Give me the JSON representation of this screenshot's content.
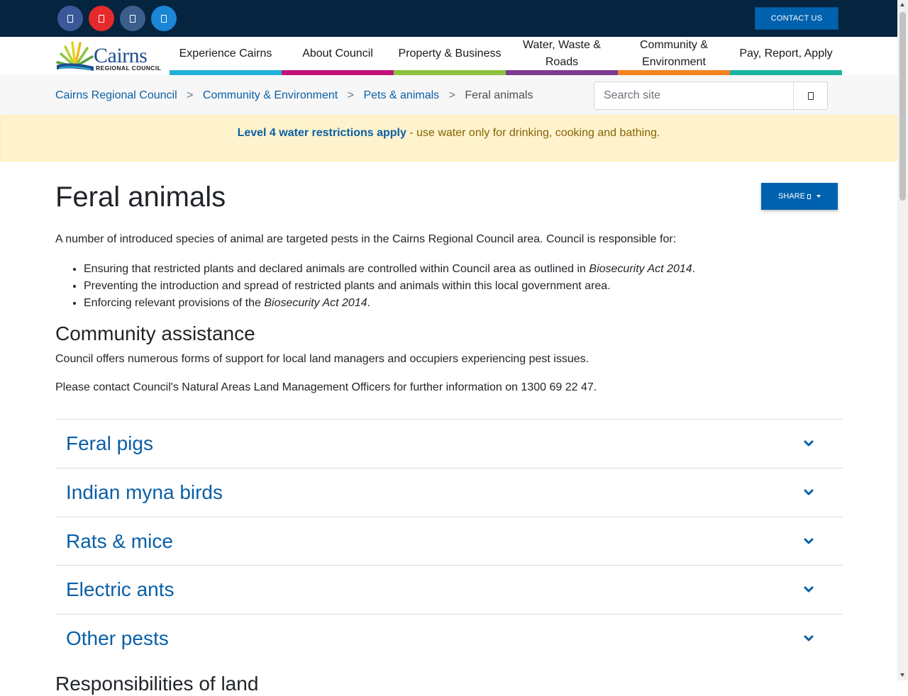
{
  "colors": {
    "topbar": "#05243f",
    "primary": "#0062ae",
    "link": "#0a5fa6",
    "facebook": "#3b5998",
    "youtube": "#e62a2a",
    "instagram": "#3a5f8c",
    "twitter": "#1b85d6",
    "alert_bg": "#fff3cd",
    "alert_text": "#856404"
  },
  "topbar": {
    "social": [
      {
        "name": "facebook-icon"
      },
      {
        "name": "youtube-icon"
      },
      {
        "name": "instagram-icon"
      },
      {
        "name": "twitter-icon"
      }
    ],
    "contact_label": "CONTACT US"
  },
  "logo": {
    "word": "Cairns",
    "sub": "REGIONAL COUNCIL"
  },
  "nav": {
    "items": [
      {
        "label": "Experience Cairns",
        "color": "#23b1d9"
      },
      {
        "label": "About Council",
        "color": "#c2127a"
      },
      {
        "label": "Property & Business",
        "color": "#8cc43f"
      },
      {
        "label": "Water, Waste & Roads",
        "color": "#7b3a8f"
      },
      {
        "label": "Community & Environment",
        "color": "#f5821f"
      },
      {
        "label": "Pay, Report, Apply",
        "color": "#19b3a0"
      }
    ]
  },
  "breadcrumb": {
    "items": [
      "Cairns Regional Council",
      "Community & Environment",
      "Pets & animals"
    ],
    "current": "Feral animals",
    "separator": ">"
  },
  "search": {
    "placeholder": "Search site",
    "button_icon": "search-icon"
  },
  "alert": {
    "strong": "Level 4 water restrictions apply",
    "rest": " - use water only for drinking, cooking and bathing."
  },
  "page": {
    "title": "Feral animals",
    "share_label": "SHARE",
    "intro": "A number of introduced species of animal are targeted pests in the Cairns Regional Council area. Council is responsible for:",
    "bullets": [
      {
        "text": "Ensuring that restricted plants and declared animals are controlled within Council area as outlined in ",
        "em": "Biosecurity Act 2014",
        "after": "."
      },
      {
        "text": "Preventing the introduction and spread of restricted plants and animals within this local government area.",
        "em": "",
        "after": ""
      },
      {
        "text": "Enforcing relevant provisions of the ",
        "em": "Biosecurity Act 2014",
        "after": "."
      }
    ],
    "section_heading": "Community assistance",
    "para1": "Council offers numerous forms of support for local land managers and occupiers experiencing pest issues.",
    "para2": "Please contact Council's Natural Areas Land Management Officers for further information on 1300 69 22 47.",
    "accordion": [
      "Feral pigs",
      "Indian myna birds",
      "Rats & mice",
      "Electric ants",
      "Other pests"
    ],
    "next_heading": "Responsibilities of land"
  }
}
